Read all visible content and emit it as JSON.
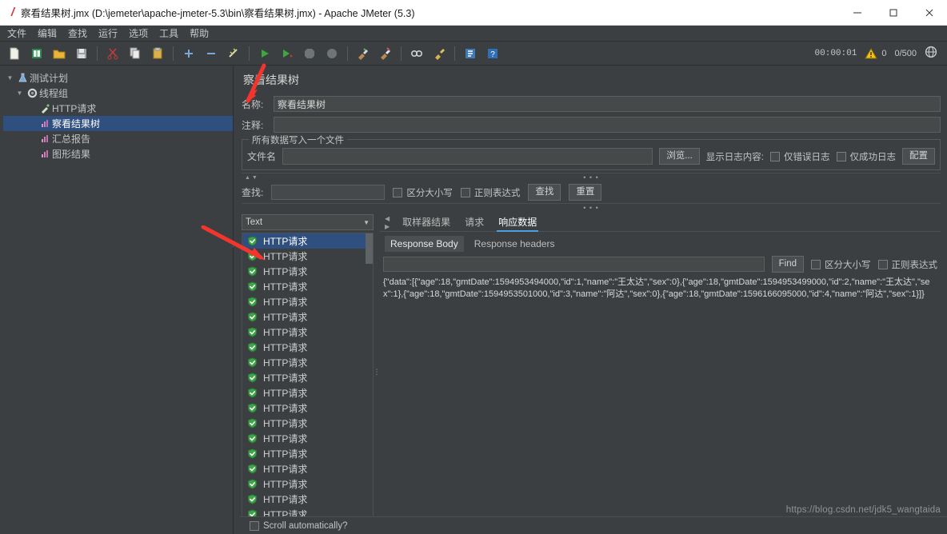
{
  "window": {
    "title": "察看结果树.jmx (D:\\jemeter\\apache-jmeter-5.3\\bin\\察看结果树.jmx) - Apache JMeter (5.3)",
    "app_icon": "jmeter-feather-icon",
    "minimize": "—",
    "maximize": "☐",
    "close": "✕"
  },
  "menu": {
    "items": [
      {
        "label": "文件"
      },
      {
        "label": "编辑"
      },
      {
        "label": "查找"
      },
      {
        "label": "运行"
      },
      {
        "label": "选项"
      },
      {
        "label": "工具"
      },
      {
        "label": "帮助"
      }
    ]
  },
  "toolbar": {
    "buttons": [
      {
        "name": "new-icon"
      },
      {
        "name": "templates-icon"
      },
      {
        "name": "open-icon"
      },
      {
        "name": "save-icon"
      },
      {
        "name": "cut-icon"
      },
      {
        "name": "copy-icon"
      },
      {
        "name": "paste-icon"
      },
      {
        "name": "expand-all-icon"
      },
      {
        "name": "collapse-all-icon"
      },
      {
        "name": "toggle-icon"
      },
      {
        "name": "start-icon"
      },
      {
        "name": "start-no-pauses-icon"
      },
      {
        "name": "stop-icon"
      },
      {
        "name": "shutdown-icon"
      },
      {
        "name": "clear-icon"
      },
      {
        "name": "clear-all-icon"
      },
      {
        "name": "search-icon"
      },
      {
        "name": "search-reset-icon"
      },
      {
        "name": "function-helper-icon"
      },
      {
        "name": "help-icon"
      }
    ],
    "status": {
      "elapsed": "00:00:01",
      "warning_icon": "warning-triangle-icon",
      "warning_count": "0",
      "threads": "0/500",
      "remote_icon": "globe-icon"
    }
  },
  "tree": {
    "nodes": [
      {
        "label": "测试计划",
        "icon": "test-plan-icon",
        "depth": 0,
        "expanded": true,
        "selected": false
      },
      {
        "label": "线程组",
        "icon": "thread-group-icon",
        "depth": 1,
        "expanded": true,
        "selected": false
      },
      {
        "label": "HTTP请求",
        "icon": "http-request-icon",
        "depth": 2,
        "expanded": null,
        "selected": false
      },
      {
        "label": "察看结果树",
        "icon": "view-results-tree-icon",
        "depth": 2,
        "expanded": null,
        "selected": true
      },
      {
        "label": "汇总报告",
        "icon": "summary-report-icon",
        "depth": 2,
        "expanded": null,
        "selected": false
      },
      {
        "label": "图形结果",
        "icon": "graph-results-icon",
        "depth": 2,
        "expanded": null,
        "selected": false
      }
    ]
  },
  "panel": {
    "title": "察看结果树",
    "name_label": "名称:",
    "name_value": "察看结果树",
    "comment_label": "注释:",
    "comment_value": "",
    "file_group": {
      "legend": "所有数据写入一个文件",
      "filename_label": "文件名",
      "filename_value": "",
      "browse_button": "浏览...",
      "log_display_label": "显示日志内容:",
      "errors_only_label": "仅错误日志",
      "errors_only_checked": false,
      "success_only_label": "仅成功日志",
      "success_only_checked": false,
      "config_button": "配置"
    },
    "search": {
      "label": "查找:",
      "value": "",
      "case_label": "区分大小写",
      "case_checked": false,
      "regex_label": "正则表达式",
      "regex_checked": false,
      "find_button": "查找",
      "reset_button": "重置"
    }
  },
  "results": {
    "renderer": "Text",
    "items": [
      {
        "label": "HTTP请求",
        "status": "success",
        "selected": true
      },
      {
        "label": "HTTP请求",
        "status": "success",
        "selected": false
      },
      {
        "label": "HTTP请求",
        "status": "success",
        "selected": false
      },
      {
        "label": "HTTP请求",
        "status": "success",
        "selected": false
      },
      {
        "label": "HTTP请求",
        "status": "success",
        "selected": false
      },
      {
        "label": "HTTP请求",
        "status": "success",
        "selected": false
      },
      {
        "label": "HTTP请求",
        "status": "success",
        "selected": false
      },
      {
        "label": "HTTP请求",
        "status": "success",
        "selected": false
      },
      {
        "label": "HTTP请求",
        "status": "success",
        "selected": false
      },
      {
        "label": "HTTP请求",
        "status": "success",
        "selected": false
      },
      {
        "label": "HTTP请求",
        "status": "success",
        "selected": false
      },
      {
        "label": "HTTP请求",
        "status": "success",
        "selected": false
      },
      {
        "label": "HTTP请求",
        "status": "success",
        "selected": false
      },
      {
        "label": "HTTP请求",
        "status": "success",
        "selected": false
      },
      {
        "label": "HTTP请求",
        "status": "success",
        "selected": false
      },
      {
        "label": "HTTP请求",
        "status": "success",
        "selected": false
      },
      {
        "label": "HTTP请求",
        "status": "success",
        "selected": false
      },
      {
        "label": "HTTP请求",
        "status": "success",
        "selected": false
      },
      {
        "label": "HTTP请求",
        "status": "success",
        "selected": false
      }
    ],
    "scroll_auto_label": "Scroll automatically?",
    "scroll_auto_checked": false
  },
  "detail": {
    "tabs": [
      {
        "label": "取样器结果",
        "active": false
      },
      {
        "label": "请求",
        "active": false
      },
      {
        "label": "响应数据",
        "active": true
      }
    ],
    "subtabs": [
      {
        "label": "Response Body",
        "active": true
      },
      {
        "label": "Response headers",
        "active": false
      }
    ],
    "find": {
      "value": "",
      "button": "Find",
      "case_label": "区分大小写",
      "case_checked": false,
      "regex_label": "正则表达式",
      "regex_checked": false
    },
    "response_body": "{\"data\":[{\"age\":18,\"gmtDate\":1594953494000,\"id\":1,\"name\":\"王太达\",\"sex\":0},{\"age\":18,\"gmtDate\":1594953499000,\"id\":2,\"name\":\"王太达\",\"sex\":1},{\"age\":18,\"gmtDate\":1594953501000,\"id\":3,\"name\":\"阿达\",\"sex\":0},{\"age\":18,\"gmtDate\":1596166095000,\"id\":4,\"name\":\"阿达\",\"sex\":1}]}"
  },
  "watermark": "https://blog.csdn.net/jdk5_wangtaida",
  "colors": {
    "window_bg": "#3c3f41",
    "selection": "#2f4f7f",
    "accent_tab": "#4e9fe0",
    "success_green": "#4caf50",
    "arrow_red": "#f4352e"
  }
}
